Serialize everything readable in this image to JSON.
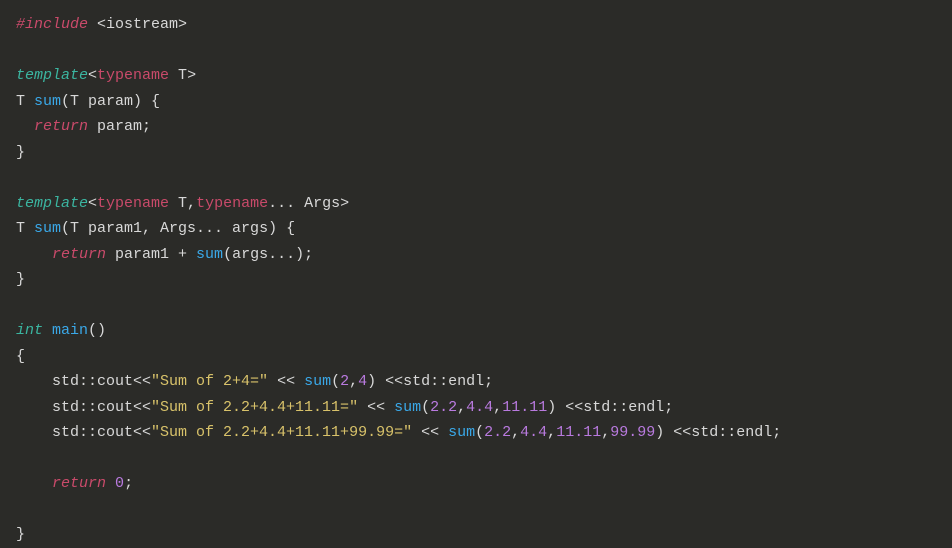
{
  "line1_include": "#include",
  "line1_header": "<iostream>",
  "line3_template": "template",
  "line3_open": "<",
  "line3_typename": "typename",
  "line3_T": " T",
  "line3_close": ">",
  "line4_T": "T ",
  "line4_sum": "sum",
  "line4_rest": "(T param) {",
  "line5_return": "return",
  "line5_rest": " param;",
  "line6_brace": "}",
  "line8_template": "template",
  "line8_open": "<",
  "line8_typename1": "typename",
  "line8_T": " T,",
  "line8_typename2": "typename",
  "line8_args": "... Args",
  "line8_close": ">",
  "line9_T": "T ",
  "line9_sum": "sum",
  "line9_rest": "(T param1, Args... args) {",
  "line10_return": "return",
  "line10_mid": " param1 + ",
  "line10_sum": "sum",
  "line10_rest": "(args...);",
  "line11_brace": "}",
  "line13_int": "int",
  "line13_main": " main",
  "line13_rest": "()",
  "line14_brace": "{",
  "line15_pre": "    std::cout<<",
  "line15_str": "\"Sum of 2+4=\"",
  "line15_mid": " << ",
  "line15_sum": "sum",
  "line15_p1": "(",
  "line15_n1": "2",
  "line15_c1": ",",
  "line15_n2": "4",
  "line15_p2": ") <<std::endl;",
  "line16_pre": "    std::cout<<",
  "line16_str": "\"Sum of 2.2+4.4+11.11=\"",
  "line16_mid": " << ",
  "line16_sum": "sum",
  "line16_p1": "(",
  "line16_n1": "2.2",
  "line16_c1": ",",
  "line16_n2": "4.4",
  "line16_c2": ",",
  "line16_n3": "11.11",
  "line16_p2": ") <<std::endl;",
  "line17_pre": "    std::cout<<",
  "line17_str": "\"Sum of 2.2+4.4+11.11+99.99=\"",
  "line17_mid": " << ",
  "line17_sum": "sum",
  "line17_p1": "(",
  "line17_n1": "2.2",
  "line17_c1": ",",
  "line17_n2": "4.4",
  "line17_c2": ",",
  "line17_n3": "11.11",
  "line17_c3": ",",
  "line17_n4": "99.99",
  "line17_p2": ") <<std::endl;",
  "line19_return": "return",
  "line19_sp": " ",
  "line19_zero": "0",
  "line19_semi": ";",
  "line21_brace": "}"
}
